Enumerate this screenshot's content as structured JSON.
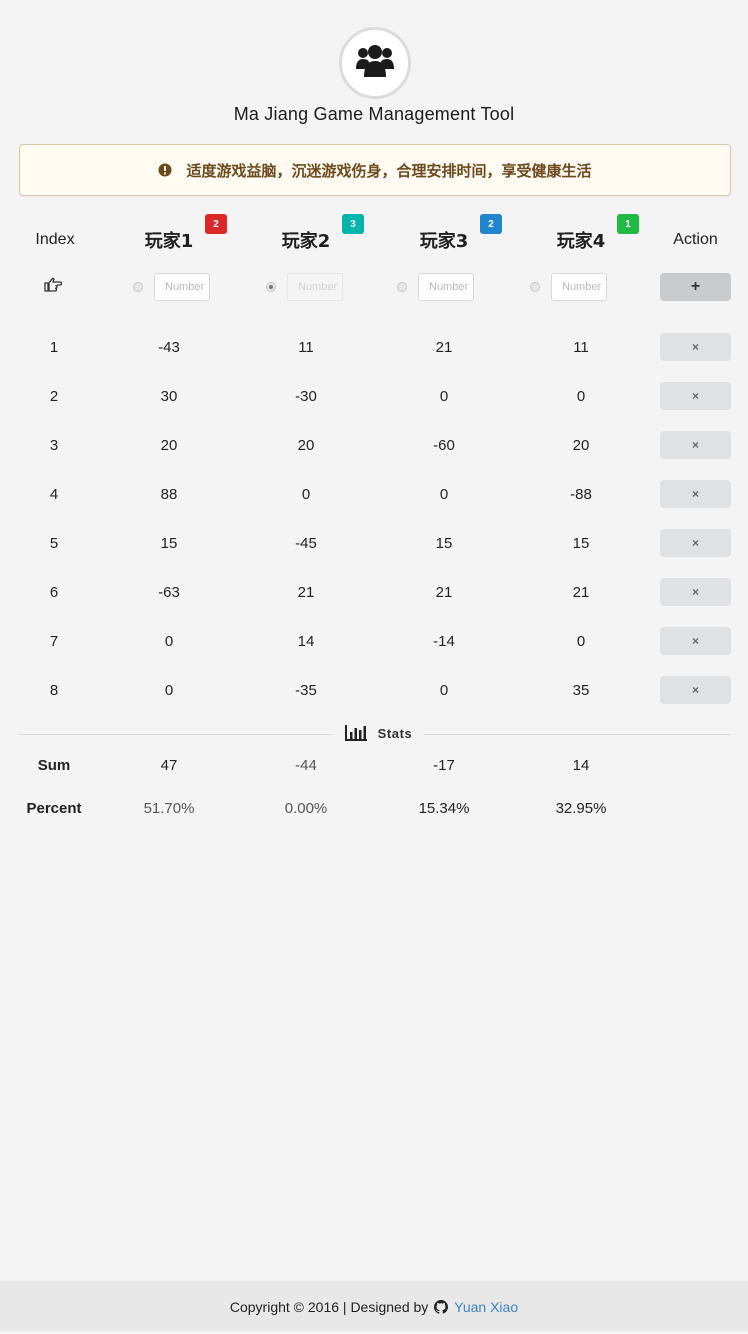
{
  "header": {
    "title": "Ma Jiang Game Management Tool",
    "logo_icon": "users-icon"
  },
  "warning": {
    "icon": "exclamation-circle-icon",
    "text": "适度游戏益脑，沉迷游戏伤身，合理安排时间，享受健康生活"
  },
  "table": {
    "index_header": "Index",
    "action_header": "Action",
    "players": [
      {
        "name": "玩家1",
        "badge": "2",
        "badge_color": "#db2828"
      },
      {
        "name": "玩家2",
        "badge": "3",
        "badge_color": "#00b5ad"
      },
      {
        "name": "玩家3",
        "badge": "2",
        "badge_color": "#2185d0"
      },
      {
        "name": "玩家4",
        "badge": "1",
        "badge_color": "#21ba45"
      }
    ],
    "input_row": {
      "pointer_icon": "hand-point-right-icon",
      "placeholder": "Number",
      "selected_radio": 2,
      "add_label": "+"
    },
    "rows": [
      {
        "index": "1",
        "scores": [
          "-43",
          "11",
          "21",
          "11"
        ]
      },
      {
        "index": "2",
        "scores": [
          "30",
          "-30",
          "0",
          "0"
        ]
      },
      {
        "index": "3",
        "scores": [
          "20",
          "20",
          "-60",
          "20"
        ]
      },
      {
        "index": "4",
        "scores": [
          "88",
          "0",
          "0",
          "-88"
        ]
      },
      {
        "index": "5",
        "scores": [
          "15",
          "-45",
          "15",
          "15"
        ]
      },
      {
        "index": "6",
        "scores": [
          "-63",
          "21",
          "21",
          "21"
        ]
      },
      {
        "index": "7",
        "scores": [
          "0",
          "14",
          "-14",
          "0"
        ]
      },
      {
        "index": "8",
        "scores": [
          "0",
          "-35",
          "0",
          "35"
        ]
      }
    ],
    "delete_label": "×"
  },
  "stats": {
    "label": "Stats",
    "icon": "bar-chart-icon",
    "sum_label": "Sum",
    "sums": [
      "47",
      "-44",
      "-17",
      "14"
    ],
    "percent_label": "Percent",
    "percents": [
      "51.70%",
      "0.00%",
      "15.34%",
      "32.95%"
    ]
  },
  "footer": {
    "copyright": "Copyright © 2016 | Designed by",
    "github_icon": "github-icon",
    "author": "Yuan Xiao",
    "author_color": "#3b83c3"
  }
}
